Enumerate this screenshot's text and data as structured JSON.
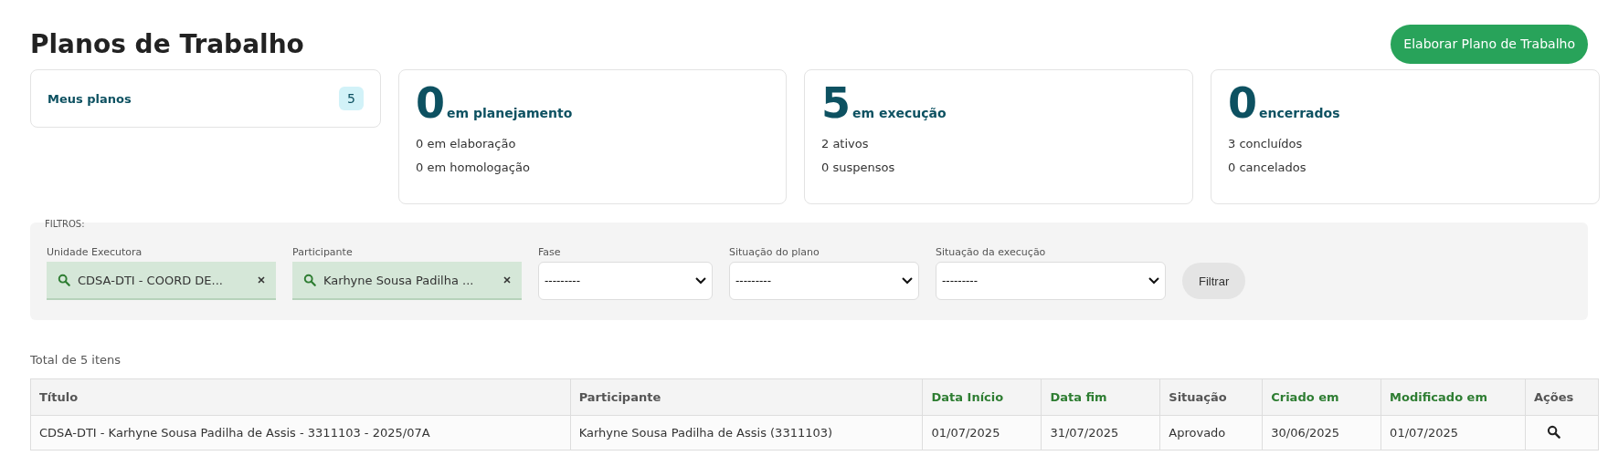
{
  "title": "Planos de Trabalho",
  "primary_action": "Elaborar Plano de Trabalho",
  "my_plans": {
    "label": "Meus planos",
    "count": "5"
  },
  "summary_cards": [
    {
      "number": "0",
      "label": "em planejamento",
      "details": [
        "0 em elaboração",
        "0 em homologação"
      ]
    },
    {
      "number": "5",
      "label": "em execução",
      "details": [
        "2 ativos",
        "0 suspensos"
      ]
    },
    {
      "number": "0",
      "label": "encerrados",
      "details": [
        "3 concluídos",
        "0 cancelados"
      ]
    }
  ],
  "filters": {
    "legend": "FILTROS:",
    "fields": [
      {
        "kind": "tag",
        "label": "Unidade Executora",
        "value": "CDSA-DTI - COORD DE..."
      },
      {
        "kind": "tag",
        "label": "Participante",
        "value": "Karhyne Sousa Padilha ..."
      },
      {
        "kind": "select",
        "label": "Fase",
        "value": "---------"
      },
      {
        "kind": "select",
        "label": "Situação do plano",
        "value": "---------"
      },
      {
        "kind": "select",
        "label": "Situação da execução",
        "value": "---------"
      }
    ],
    "button": "Filtrar"
  },
  "total": "Total de 5 itens",
  "table": {
    "columns": [
      {
        "label": "Título",
        "sortable": false
      },
      {
        "label": "Participante",
        "sortable": false
      },
      {
        "label": "Data Início",
        "sortable": true
      },
      {
        "label": "Data fim",
        "sortable": true
      },
      {
        "label": "Situação",
        "sortable": false
      },
      {
        "label": "Criado em",
        "sortable": true
      },
      {
        "label": "Modificado em",
        "sortable": true
      },
      {
        "label": "Ações",
        "sortable": false
      }
    ],
    "rows": [
      {
        "cells": [
          "CDSA-DTI - Karhyne Sousa Padilha de Assis - 3311103 - 2025/07A",
          "Karhyne Sousa Padilha de Assis (3311103)",
          "01/07/2025",
          "31/07/2025",
          "Aprovado",
          "30/06/2025",
          "01/07/2025"
        ]
      }
    ]
  }
}
